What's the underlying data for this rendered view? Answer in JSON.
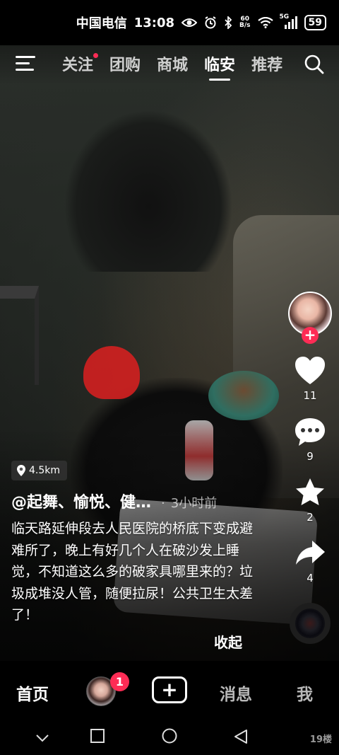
{
  "status_bar": {
    "carrier": "中国电信",
    "time": "13:08",
    "net_speed_value": "60",
    "net_speed_unit": "B/s",
    "signal_label": "5G",
    "battery": "59"
  },
  "top_nav": {
    "tabs": [
      {
        "label": "关注",
        "has_dot": true
      },
      {
        "label": "团购"
      },
      {
        "label": "商城"
      },
      {
        "label": "临安",
        "active": true
      },
      {
        "label": "推荐"
      }
    ]
  },
  "video": {
    "location_distance": "4.5km",
    "author": "@起舞、愉悦、健…",
    "separator": "·",
    "posted_time": "3小时前",
    "caption": "临天路延伸段去人民医院的桥底下变成避难所了，晚上有好几个人在破沙发上睡觉，不知道这么多的破家具哪里来的？垃圾成堆没人管，随便拉尿！公共卫生太差了！",
    "collapse_label": "收起"
  },
  "actions": {
    "like_count": "11",
    "comment_count": "9",
    "favorite_count": "2",
    "share_count": "4"
  },
  "bottom_nav": {
    "home": "首页",
    "friends_badge": "1",
    "messages": "消息",
    "me": "我"
  },
  "watermark": "19楼",
  "colors": {
    "accent": "#fe2c55",
    "background": "#000000"
  }
}
